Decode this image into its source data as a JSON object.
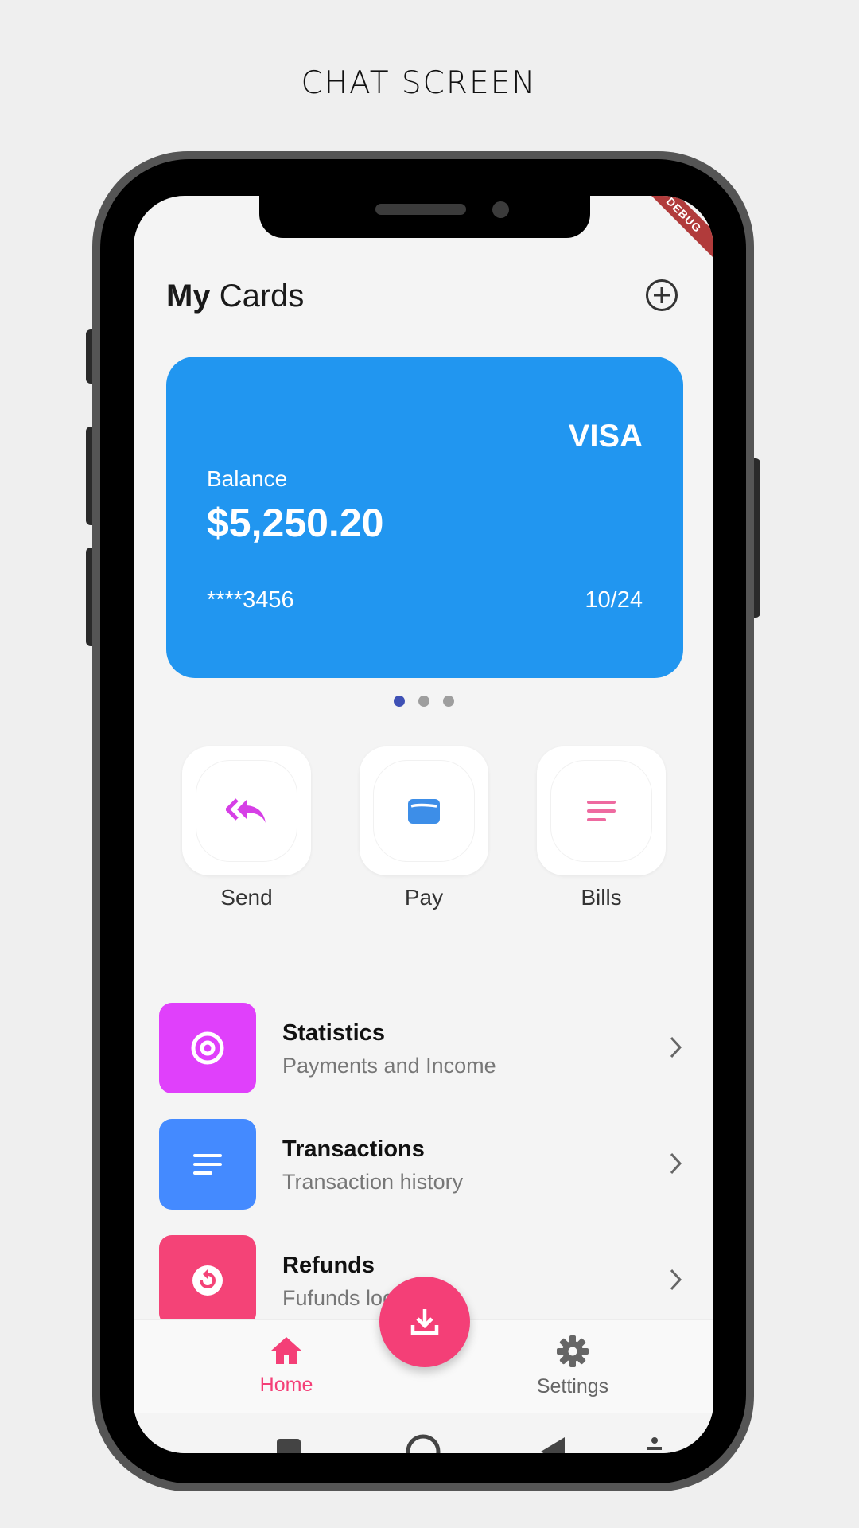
{
  "page_caption": "CHAT SCREEN",
  "debug_banner": "DEBUG",
  "header": {
    "title_bold": "My",
    "title_rest": " Cards",
    "add_icon": "add-circle-icon"
  },
  "card": {
    "brand": "VISA",
    "balance_label": "Balance",
    "balance": "$5,250.20",
    "number": "****3456",
    "expiry": "10/24",
    "color": "#2196f0"
  },
  "carousel": {
    "pages": 3,
    "active_index": 0
  },
  "actions": [
    {
      "label": "Send",
      "icon": "reply-all-icon",
      "color": "#d63fe6"
    },
    {
      "label": "Pay",
      "icon": "wallet-icon",
      "color": "#3d8ee8"
    },
    {
      "label": "Bills",
      "icon": "notes-icon",
      "color": "#ee6aa0"
    }
  ],
  "list": [
    {
      "title": "Statistics",
      "subtitle": "Payments and Income",
      "icon": "at-sign-icon",
      "color": "#e040fb"
    },
    {
      "title": "Transactions",
      "subtitle": "Transaction history",
      "icon": "list-icon",
      "color": "#448aff"
    },
    {
      "title": "Refunds",
      "subtitle": "Fufunds log",
      "icon": "refund-icon",
      "color": "#f44377"
    }
  ],
  "bottom_nav": {
    "home_label": "Home",
    "settings_label": "Settings",
    "active": "Home",
    "active_color": "#f43f77",
    "inactive_color": "#666666"
  },
  "fab": {
    "icon": "download-icon",
    "color": "#f43f77"
  }
}
